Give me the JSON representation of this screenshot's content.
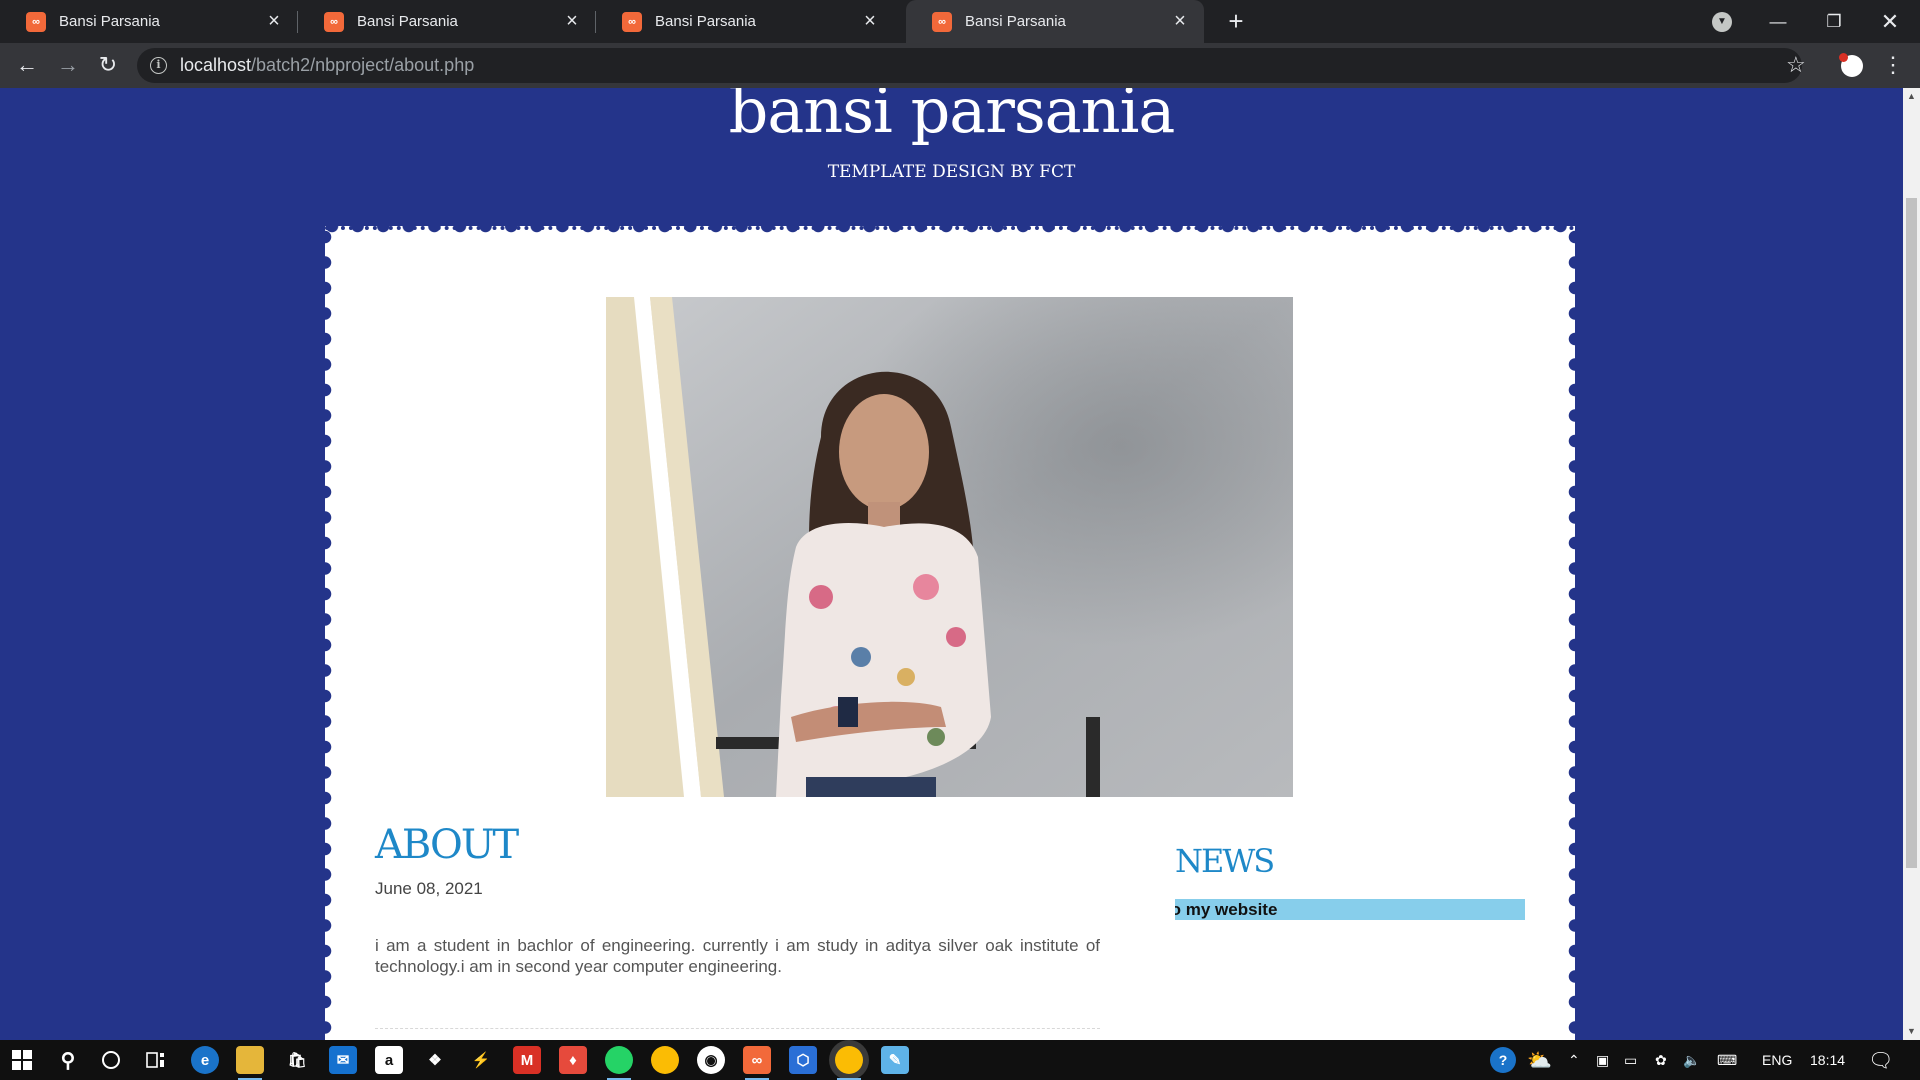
{
  "browser": {
    "tabs": [
      {
        "title": "Bansi Parsania",
        "favicon": "xampp-icon",
        "active": false
      },
      {
        "title": "Bansi Parsania",
        "favicon": "xampp-icon",
        "active": false
      },
      {
        "title": "Bansi Parsania",
        "favicon": "xampp-icon",
        "active": false
      },
      {
        "title": "Bansi Parsania",
        "favicon": "xampp-icon",
        "active": true
      }
    ],
    "url_host": "localhost",
    "url_path": "/batch2/nbproject/about.php"
  },
  "site": {
    "title": "bansi parsania",
    "tagline": "TEMPLATE DESIGN BY FCT"
  },
  "about": {
    "heading": "ABOUT",
    "date": "June 08, 2021",
    "body": "i am a student in bachlor of engineering. currently i am study in aditya silver oak institute of technology.i am in second year computer engineering."
  },
  "news": {
    "heading": "NEWS",
    "marquee_text": "to my website"
  },
  "taskbar": {
    "language": "ENG",
    "time": "18:14"
  },
  "colors": {
    "page_background": "#24348a",
    "heading_blue": "#1e88c8",
    "marquee_background": "#87ceeb"
  }
}
